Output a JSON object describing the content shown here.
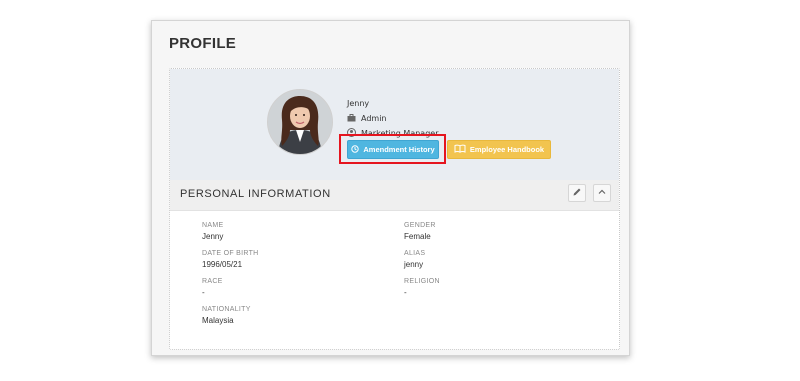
{
  "page": {
    "title": "PROFILE"
  },
  "user": {
    "name": "Jenny",
    "role": "Admin",
    "position": "Marketing Manager"
  },
  "buttons": {
    "amendment": "Amendment History",
    "handbook": "Employee Handbook"
  },
  "section": {
    "title": "PERSONAL INFORMATION"
  },
  "fields": {
    "name": {
      "label": "NAME",
      "value": "Jenny"
    },
    "gender": {
      "label": "GENDER",
      "value": "Female"
    },
    "dob": {
      "label": "DATE OF BIRTH",
      "value": "1996/05/21"
    },
    "alias": {
      "label": "ALIAS",
      "value": "jenny"
    },
    "race": {
      "label": "RACE",
      "value": "-"
    },
    "religion": {
      "label": "RELIGION",
      "value": "-"
    },
    "nationality": {
      "label": "NATIONALITY",
      "value": "Malaysia"
    }
  },
  "icons": {
    "role": "briefcase-icon",
    "position": "user-tie-icon",
    "amendment": "clock-icon",
    "handbook": "book-icon",
    "edit": "pencil-icon",
    "collapse": "chevron-up-icon"
  },
  "colors": {
    "amendment_button": "#4fb6e0",
    "handbook_button": "#f2c44f",
    "highlight": "#e5151f"
  }
}
